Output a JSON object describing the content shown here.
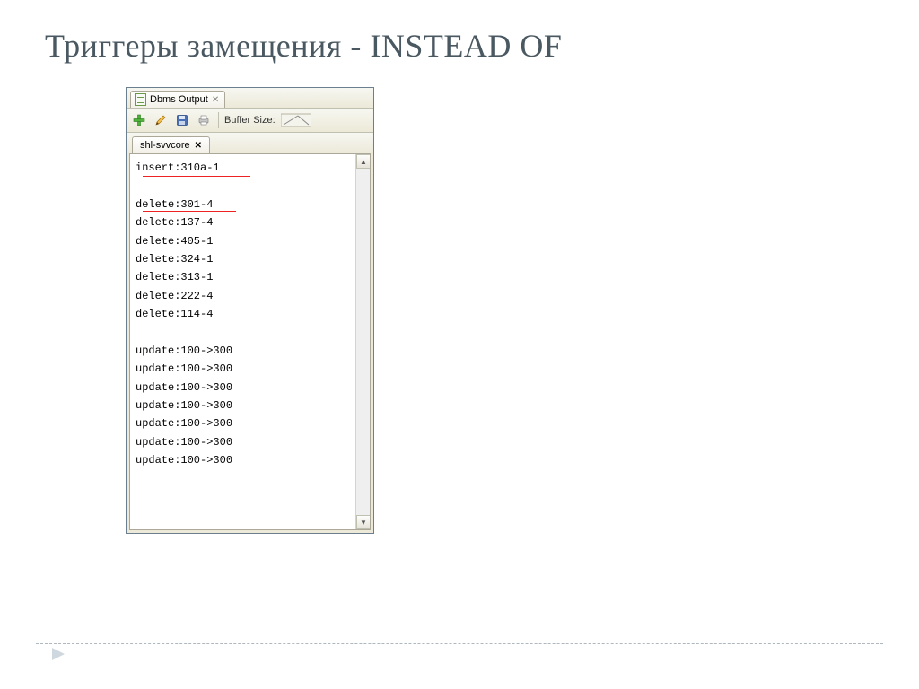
{
  "title": "Триггеры замещения - INSTEAD OF",
  "tab": {
    "label": "Dbms Output"
  },
  "toolbar": {
    "buffer_label": "Buffer Size:"
  },
  "subtab": {
    "label": "shl-svvcore"
  },
  "output_lines": [
    "insert:310a-1",
    "",
    "delete:301-4",
    "delete:137-4",
    "delete:405-1",
    "delete:324-1",
    "delete:313-1",
    "delete:222-4",
    "delete:114-4",
    "",
    "update:100->300",
    "update:100->300",
    "update:100->300",
    "update:100->300",
    "update:100->300",
    "update:100->300",
    "update:100->300"
  ]
}
